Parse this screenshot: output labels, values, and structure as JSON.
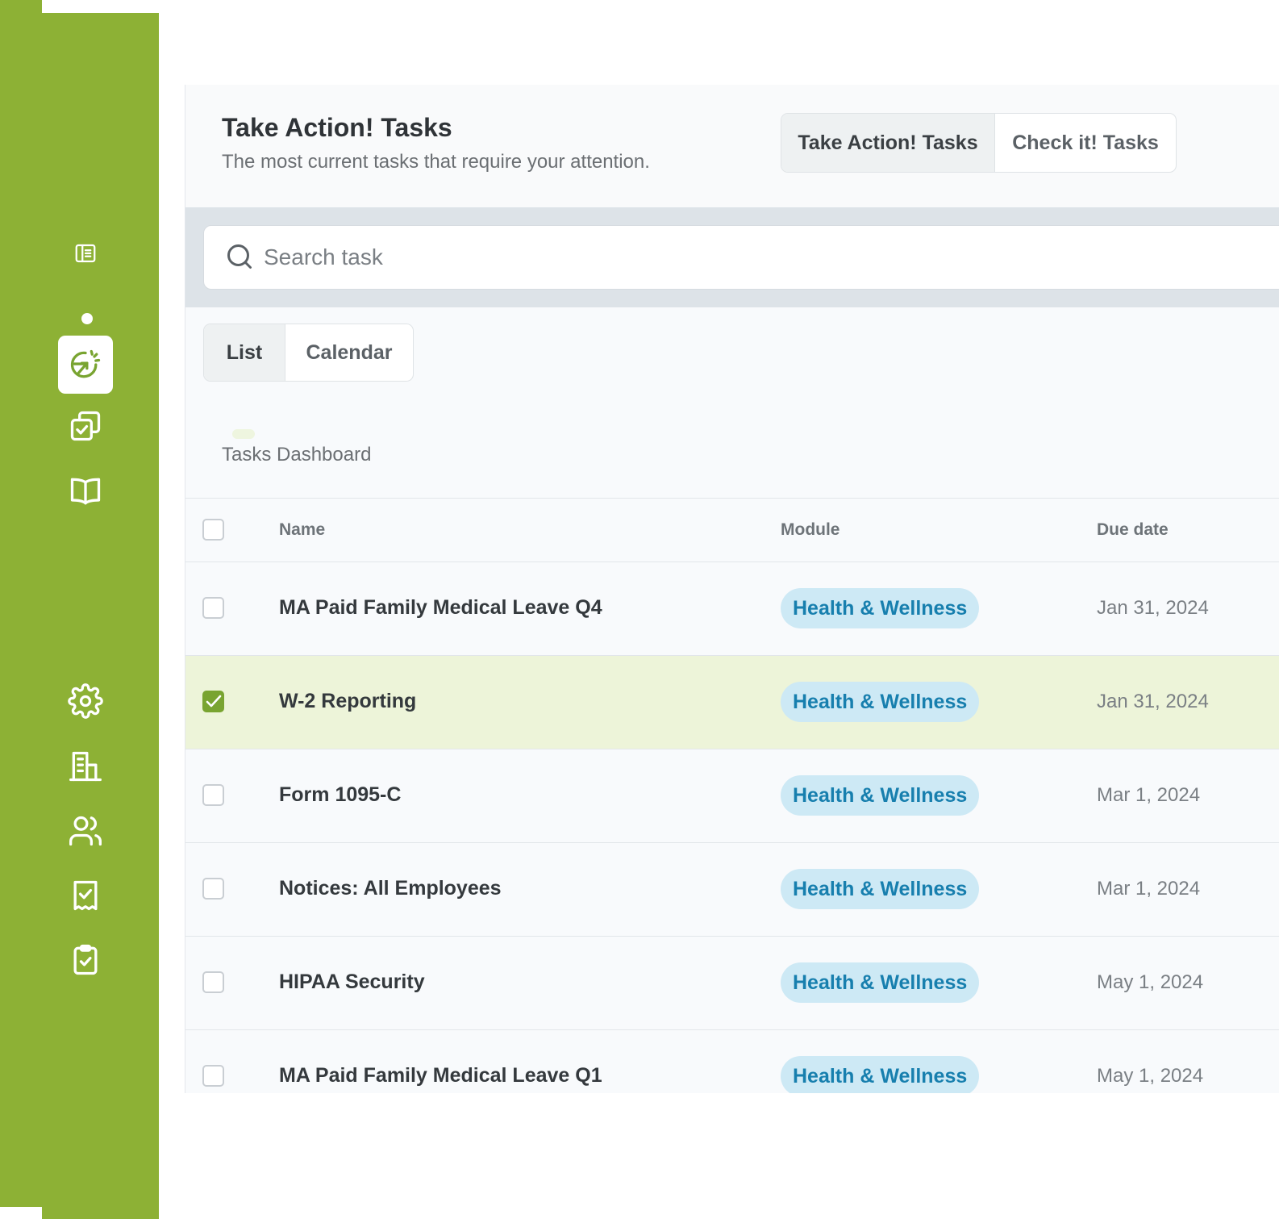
{
  "header": {
    "title": "Take Action! Tasks",
    "subtitle": "The most current tasks that require your attention."
  },
  "task_type_tabs": [
    "Take Action! Tasks",
    "Check it! Tasks"
  ],
  "task_type_selected": "Take Action! Tasks",
  "search": {
    "placeholder": "Search task"
  },
  "view_tabs": [
    "List",
    "Calendar"
  ],
  "view_selected": "List",
  "dashboard_label": "Tasks Dashboard",
  "table": {
    "columns": [
      "Name",
      "Module",
      "Due date"
    ],
    "rows": [
      {
        "name": "MA Paid Family Medical Leave Q4",
        "module": "Health & Wellness",
        "due": "Jan 31, 2024",
        "checked": false
      },
      {
        "name": "W-2 Reporting",
        "module": "Health & Wellness",
        "due": "Jan 31, 2024",
        "checked": true
      },
      {
        "name": "Form 1095-C",
        "module": "Health & Wellness",
        "due": "Mar 1, 2024",
        "checked": false
      },
      {
        "name": "Notices: All Employees",
        "module": "Health & Wellness",
        "due": "Mar 1, 2024",
        "checked": false
      },
      {
        "name": "HIPAA Security",
        "module": "Health & Wellness",
        "due": "May 1, 2024",
        "checked": false
      },
      {
        "name": "MA Paid Family Medical Leave Q1",
        "module": "Health & Wellness",
        "due": "May 1, 2024",
        "checked": false
      }
    ]
  },
  "sidebar": {
    "icons": [
      "document-list-icon",
      "take-action-icon",
      "check-tasks-icon",
      "book-icon",
      "gear-icon",
      "building-icon",
      "users-icon",
      "receipt-check-icon",
      "clipboard-check-icon"
    ],
    "active": "take-action-icon"
  },
  "colors": {
    "sidebar": "#8db135",
    "accent": "#79a431",
    "selected_row": "#edf4d9",
    "badge_bg": "#cde9f5",
    "badge_text": "#177fae"
  }
}
